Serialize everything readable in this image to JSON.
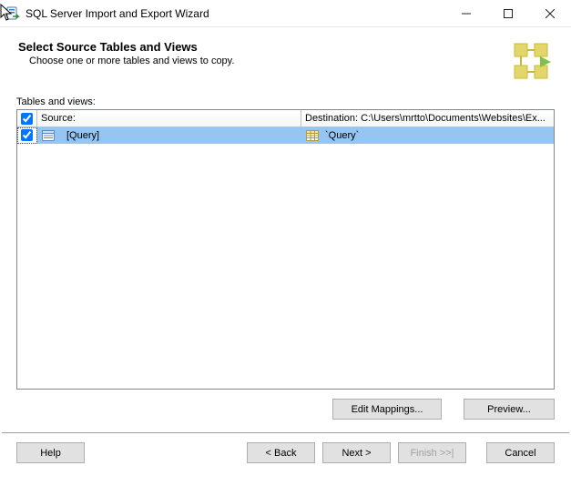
{
  "window": {
    "title": "SQL Server Import and Export Wizard"
  },
  "header": {
    "heading": "Select Source Tables and Views",
    "subheading": "Choose one or more tables and views to copy."
  },
  "content": {
    "tables_label": "Tables and views:",
    "columns": {
      "source": "Source:",
      "destination": "Destination: C:\\Users\\mrtto\\Documents\\Websites\\Ex..."
    },
    "rows": [
      {
        "checked": true,
        "source": "[Query]",
        "destination": "`Query`"
      }
    ]
  },
  "buttons": {
    "edit_mappings": "Edit Mappings...",
    "preview": "Preview...",
    "help": "Help",
    "back": "< Back",
    "next": "Next >",
    "finish": "Finish >>|",
    "cancel": "Cancel"
  }
}
